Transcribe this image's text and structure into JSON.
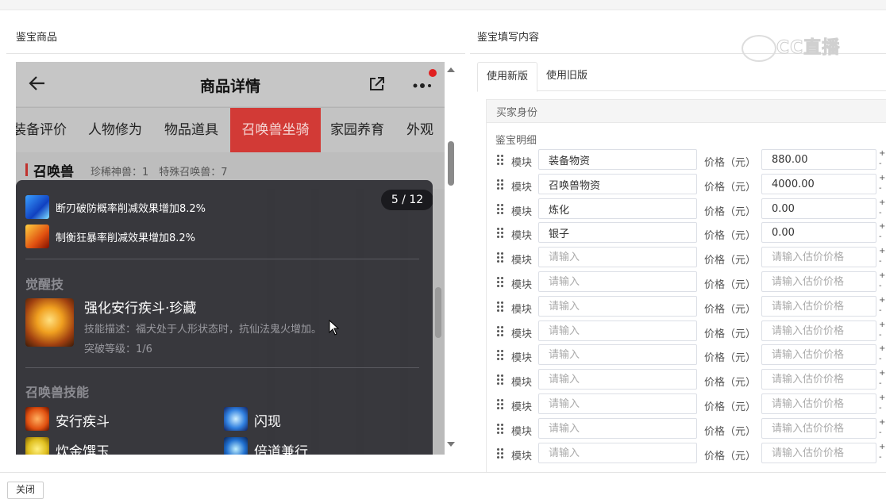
{
  "left_section_title": "鉴宝商品",
  "right_section_title": "鉴宝填写内容",
  "phone": {
    "title": "商品详情",
    "tabs": [
      "装备评价",
      "人物修为",
      "物品道具",
      "召唤兽坐骑",
      "家园养育",
      "外观"
    ],
    "active_tab": "召唤兽坐骑",
    "subheader": {
      "title": "召唤兽",
      "info": "珍稀神兽：1　特殊召唤兽：7"
    },
    "overlay": {
      "counter": "5 / 12",
      "effects": [
        "断刃破防概率削减效果增加8.2%",
        "制衡狂暴率削减效果增加8.2%"
      ],
      "awaken_title": "觉醒技",
      "awaken_skill": {
        "name": "强化安行疾斗·珍藏",
        "desc": "技能描述：福犬处于人形状态时，抗仙法鬼火增加。",
        "level": "突破等级：1/6"
      },
      "pet_skills_title": "召唤兽技能",
      "pet_skills": [
        "安行疾斗",
        "闪现",
        "炊金馔玉",
        "倍道兼行"
      ]
    }
  },
  "form": {
    "tabs": [
      "使用新版",
      "使用旧版"
    ],
    "active_tab": "使用新版",
    "buyer_identity_label": "买家身份",
    "detail_label": "鉴宝明细",
    "module_label": "模块",
    "price_label": "价格（元）",
    "name_placeholder": "请输入",
    "price_placeholder": "请输入估价价格",
    "rows": [
      {
        "name": "装备物资",
        "price": "880.00"
      },
      {
        "name": "召唤兽物资",
        "price": "4000.00"
      },
      {
        "name": "炼化",
        "price": "0.00"
      },
      {
        "name": "银子",
        "price": "0.00"
      },
      {
        "name": "",
        "price": ""
      },
      {
        "name": "",
        "price": ""
      },
      {
        "name": "",
        "price": ""
      },
      {
        "name": "",
        "price": ""
      },
      {
        "name": "",
        "price": ""
      },
      {
        "name": "",
        "price": ""
      },
      {
        "name": "",
        "price": ""
      },
      {
        "name": "",
        "price": ""
      },
      {
        "name": "",
        "price": ""
      }
    ],
    "plus": "+",
    "minus": "-"
  },
  "footer": {
    "close_label": "关闭"
  },
  "watermark": "CC直播"
}
